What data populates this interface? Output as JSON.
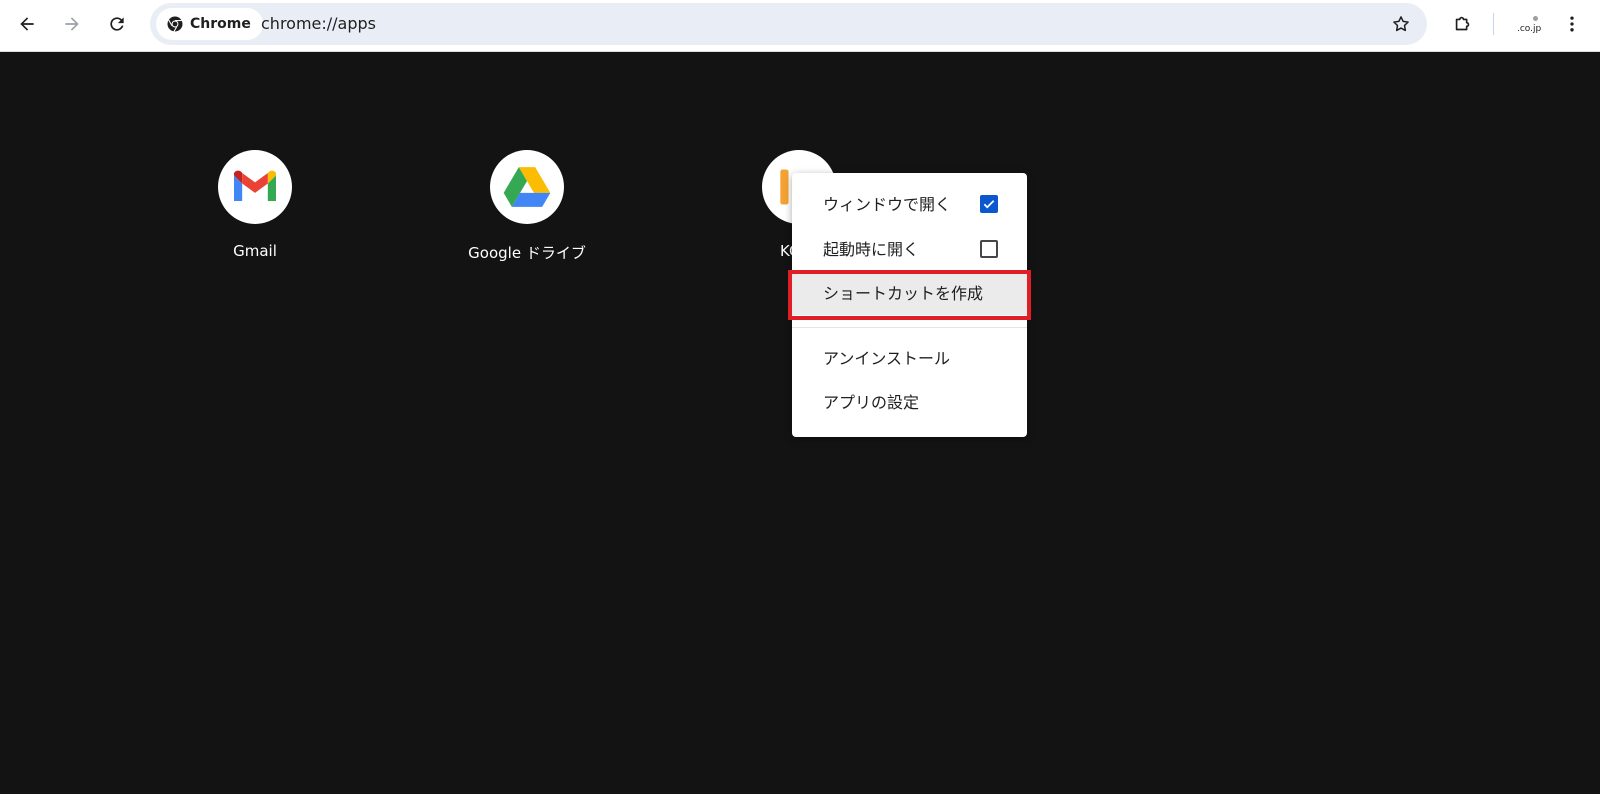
{
  "toolbar": {
    "chip_label": "Chrome",
    "url": "chrome://apps",
    "profile_label": ".co.jp"
  },
  "apps": [
    {
      "label": "Gmail"
    },
    {
      "label": "Google ドライブ"
    },
    {
      "label": "KC"
    }
  ],
  "context_menu": {
    "items": [
      {
        "label": "ウィンドウで開く",
        "checked": true
      },
      {
        "label": "起動時に開く",
        "checked": false
      },
      {
        "label": "ショートカットを作成",
        "highlighted": true
      },
      {
        "label": "アンインストール"
      },
      {
        "label": "アプリの設定"
      }
    ]
  },
  "colors": {
    "page_background": "#131313",
    "checkbox_accent": "#0b57d0",
    "highlight_box": "#e01e26"
  },
  "icons": [
    "back-arrow-icon",
    "forward-arrow-icon",
    "reload-icon",
    "chrome-logo-icon",
    "bookmark-star-icon",
    "extensions-puzzle-icon",
    "more-vert-icon",
    "gmail-icon",
    "google-drive-icon",
    "kc-app-icon",
    "checkmark-icon"
  ]
}
